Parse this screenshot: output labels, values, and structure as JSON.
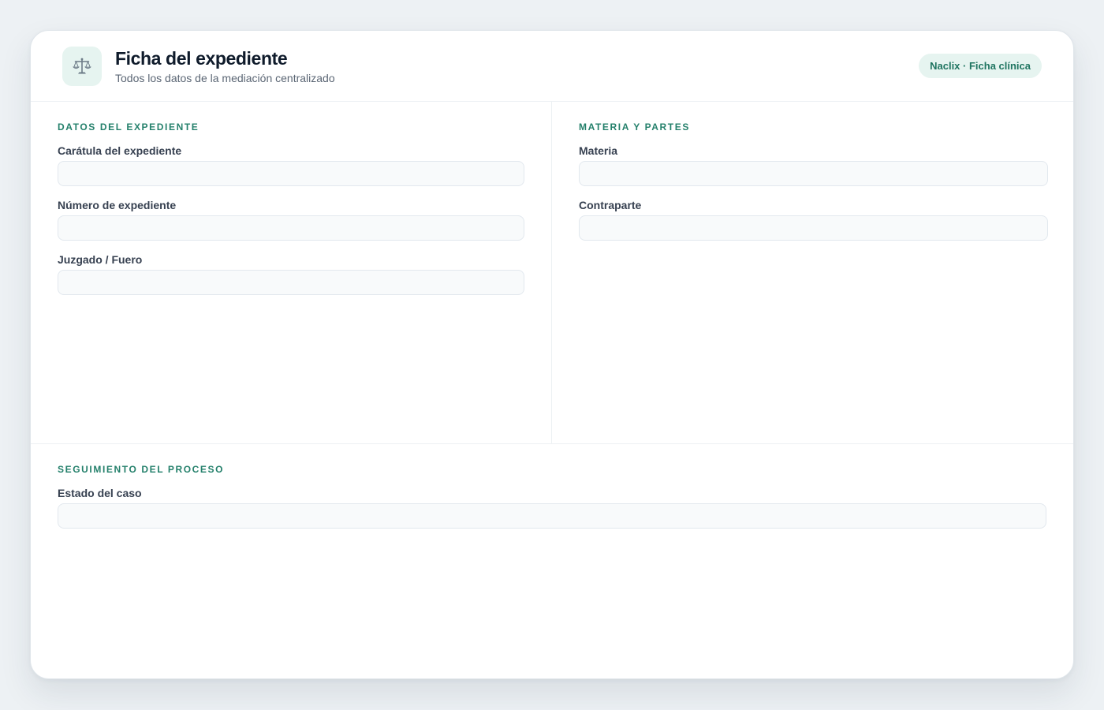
{
  "header": {
    "title": "Ficha del expediente",
    "subtitle": "Todos los datos de la mediación centralizado",
    "badge": "Naclix · Ficha clínica",
    "logo_icon": "scales-of-justice-icon"
  },
  "sections": {
    "datos": {
      "heading": "DATOS DEL EXPEDIENTE",
      "fields": [
        {
          "label": "Carátula del expediente",
          "value": "",
          "placeholder": ""
        },
        {
          "label": "Número de expediente",
          "value": "",
          "placeholder": ""
        },
        {
          "label": "Juzgado / Fuero",
          "value": "",
          "placeholder": ""
        }
      ]
    },
    "materia": {
      "heading": "MATERIA Y PARTES",
      "fields": [
        {
          "label": "Materia",
          "value": "",
          "placeholder": ""
        },
        {
          "label": "Contraparte",
          "value": "",
          "placeholder": ""
        }
      ]
    },
    "seguimiento": {
      "heading": "SEGUIMIENTO DEL PROCESO",
      "fields": [
        {
          "label": "Estado del caso",
          "value": "",
          "placeholder": ""
        }
      ]
    }
  },
  "colors": {
    "accent": "#24806b",
    "accent_bg": "#e6f4f0",
    "page_bg": "#edf1f4",
    "input_bg": "#f8fafb",
    "input_border": "#e2e8ee"
  }
}
